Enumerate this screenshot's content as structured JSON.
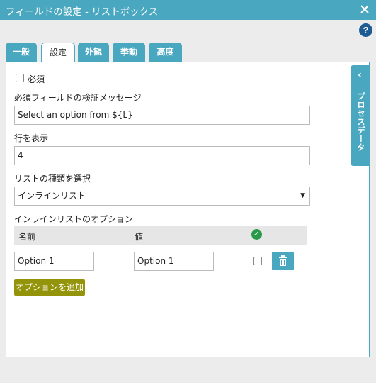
{
  "window": {
    "title": "フィールドの設定 - リストボックス",
    "close_icon": "close-icon",
    "help_icon": "help-icon",
    "help_label": "?"
  },
  "tabs": [
    {
      "label": "一般",
      "active": false
    },
    {
      "label": "設定",
      "active": true
    },
    {
      "label": "外観",
      "active": false
    },
    {
      "label": "挙動",
      "active": false
    },
    {
      "label": "高度",
      "active": false
    }
  ],
  "form": {
    "required_label": "必須",
    "required_checked": false,
    "validation_message_label": "必須フィールドの検証メッセージ",
    "validation_message_value": "Select an option from ${L}",
    "rows_label": "行を表示",
    "rows_value": "4",
    "list_type_label": "リストの種類を選択",
    "list_type_value": "インラインリスト",
    "inline_options_label": "インラインリストのオプション",
    "options_table": {
      "headers": {
        "name": "名前",
        "value": "値",
        "default_icon": "check-circle-icon"
      },
      "rows": [
        {
          "name": "Option 1",
          "value": "Option 1",
          "default_checked": false,
          "delete_icon": "trash-icon"
        }
      ]
    },
    "add_option_button": "オプションを追加"
  },
  "side_panel": {
    "label": "プロセスデータ",
    "chevron_icon": "chevron-left-icon"
  },
  "colors": {
    "accent": "#4aa7c0",
    "help": "#1d5c93",
    "add_button": "#94940b",
    "check": "#2a9a4a"
  }
}
